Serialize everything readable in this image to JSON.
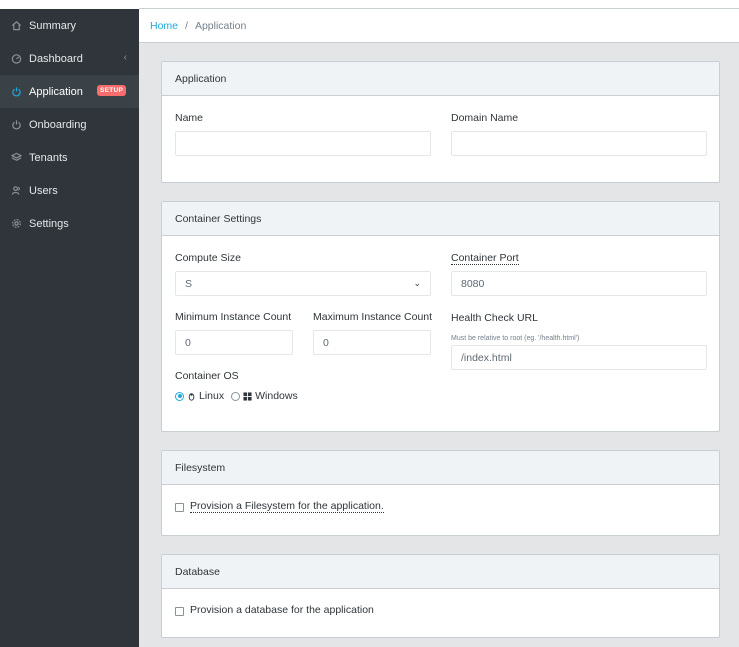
{
  "sidebar": {
    "items": [
      {
        "label": "Summary",
        "icon": "home-icon"
      },
      {
        "label": "Dashboard",
        "icon": "speedometer-icon",
        "chevron": "‹"
      },
      {
        "label": "Application",
        "icon": "power-icon",
        "badge": "SETUP",
        "active": true
      },
      {
        "label": "Onboarding",
        "icon": "power-icon"
      },
      {
        "label": "Tenants",
        "icon": "layers-icon"
      },
      {
        "label": "Users",
        "icon": "people-icon"
      },
      {
        "label": "Settings",
        "icon": "gear-icon"
      }
    ]
  },
  "breadcrumb": {
    "home": "Home",
    "separator": "/",
    "current": "Application"
  },
  "application_card": {
    "title": "Application",
    "name_label": "Name",
    "name_value": "",
    "domain_label": "Domain Name",
    "domain_value": ""
  },
  "container_card": {
    "title": "Container Settings",
    "compute_label": "Compute Size",
    "compute_value": "S",
    "port_label": "Container Port",
    "port_value": "8080",
    "min_label": "Minimum Instance Count",
    "min_value": "0",
    "max_label": "Maximum Instance Count",
    "max_value": "0",
    "health_label": "Health Check URL",
    "health_help": "Must be relative to root (eg. '/health.html')",
    "health_value": "/index.html",
    "os_label": "Container OS",
    "os_options": [
      {
        "label": "Linux",
        "checked": true,
        "icon": "linux-icon"
      },
      {
        "label": "Windows",
        "checked": false,
        "icon": "windows-icon"
      }
    ]
  },
  "filesystem_card": {
    "title": "Filesystem",
    "checkbox_label": "Provision a Filesystem for the application."
  },
  "database_card": {
    "title": "Database",
    "checkbox_label": "Provision a database for the application"
  },
  "colors": {
    "sidebar_bg": "#2f353a",
    "accent": "#20a8d8",
    "badge": "#f86c6b",
    "page_bg": "#e4e5e6"
  }
}
